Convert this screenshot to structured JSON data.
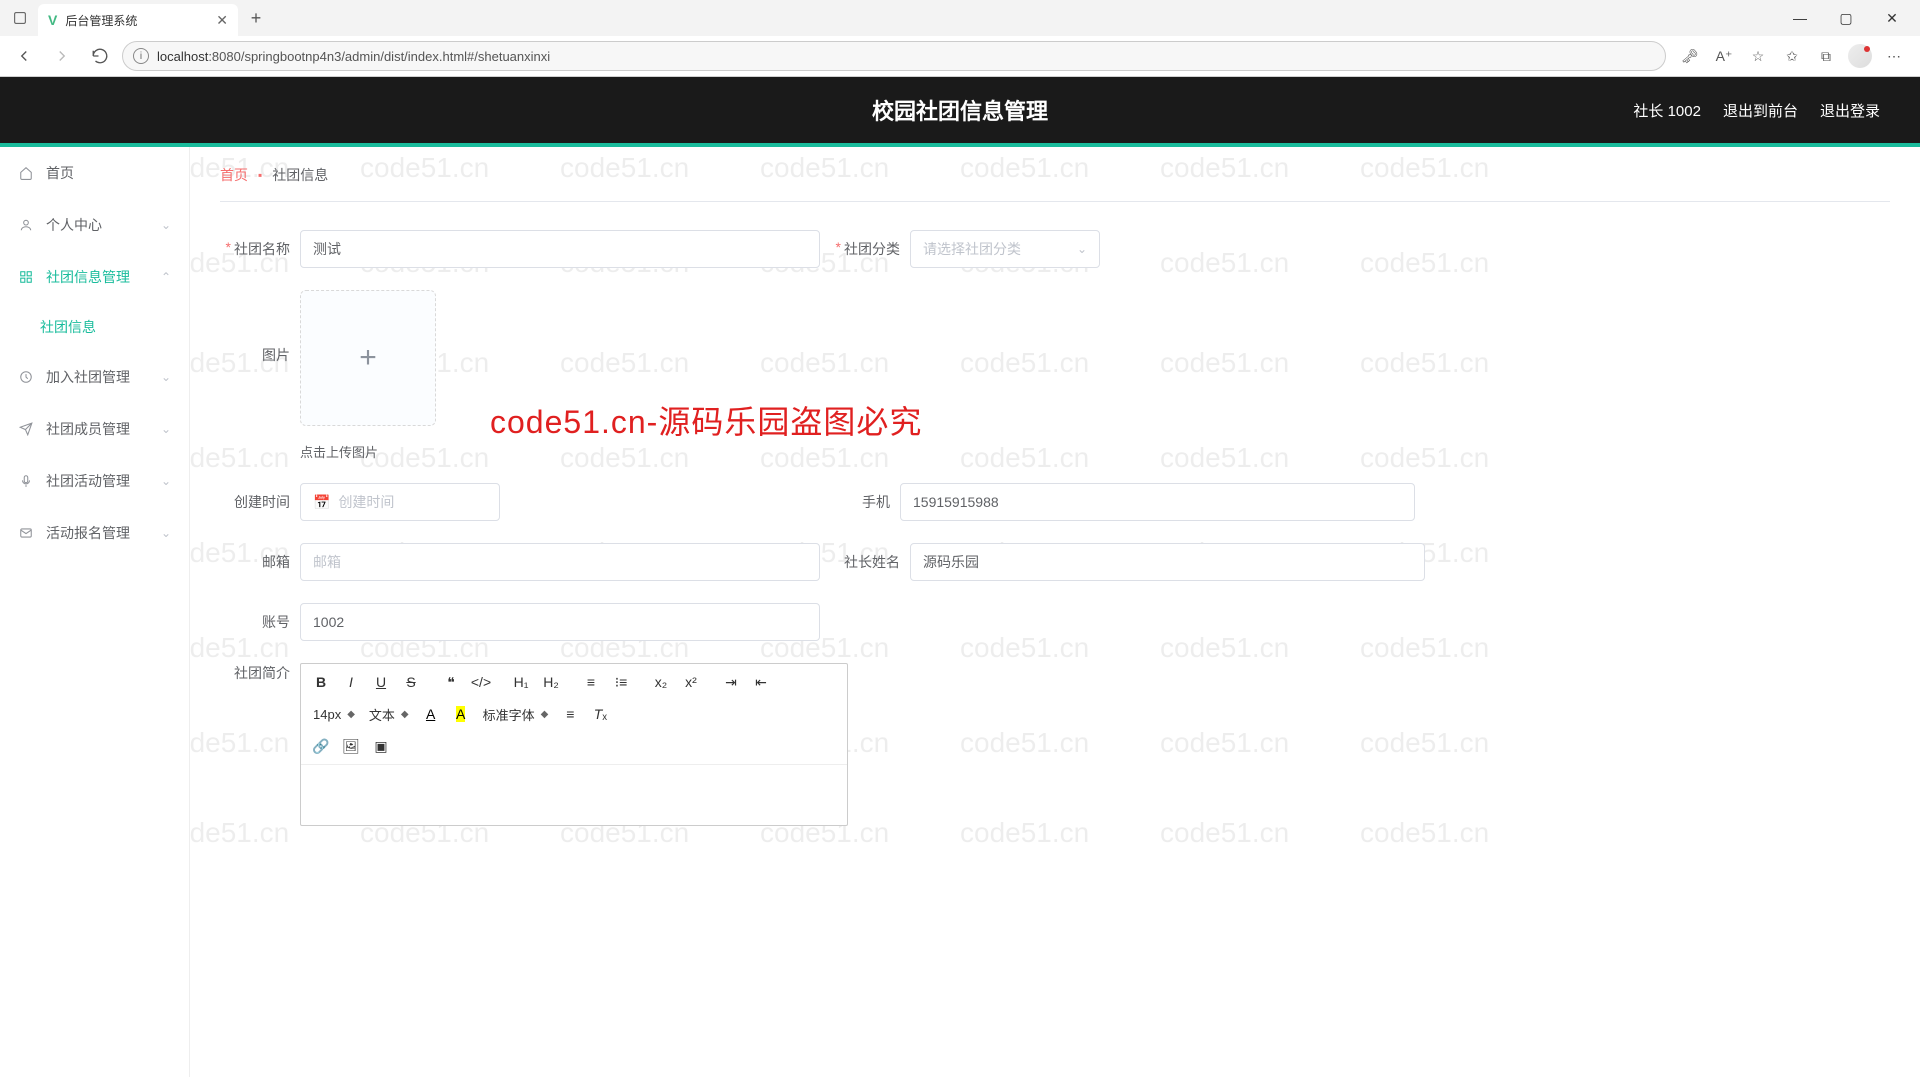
{
  "browser": {
    "tab_title": "后台管理系统",
    "url_host": "localhost",
    "url_path": ":8080/springbootnp4n3/admin/dist/index.html#/shetuanxinxi"
  },
  "header": {
    "title": "校园社团信息管理",
    "user": "社长 1002",
    "exit_front": "退出到前台",
    "logout": "退出登录"
  },
  "sidebar": {
    "items": [
      {
        "label": "首页",
        "icon": "home"
      },
      {
        "label": "个人中心",
        "icon": "user",
        "expandable": true
      },
      {
        "label": "社团信息管理",
        "icon": "grid",
        "expandable": true,
        "active": true
      },
      {
        "label": "加入社团管理",
        "icon": "clock",
        "expandable": true
      },
      {
        "label": "社团成员管理",
        "icon": "send",
        "expandable": true
      },
      {
        "label": "社团活动管理",
        "icon": "mic",
        "expandable": true
      },
      {
        "label": "活动报名管理",
        "icon": "mail",
        "expandable": true
      }
    ],
    "sub_item": "社团信息"
  },
  "breadcrumb": {
    "home": "首页",
    "current": "社团信息"
  },
  "form": {
    "name_label": "社团名称",
    "name_value": "测试",
    "category_label": "社团分类",
    "category_placeholder": "请选择社团分类",
    "image_label": "图片",
    "upload_tip": "点击上传图片",
    "create_time_label": "创建时间",
    "create_time_placeholder": "创建时间",
    "phone_label": "手机",
    "phone_value": "15915915988",
    "email_label": "邮箱",
    "email_placeholder": "邮箱",
    "leader_label": "社长姓名",
    "leader_value": "源码乐园",
    "account_label": "账号",
    "account_value": "1002",
    "intro_label": "社团简介"
  },
  "editor": {
    "font_size": "14px",
    "text_style": "文本",
    "font_family": "标准字体"
  },
  "overlay": "code51.cn-源码乐园盗图必究",
  "watermark": "code51.cn"
}
